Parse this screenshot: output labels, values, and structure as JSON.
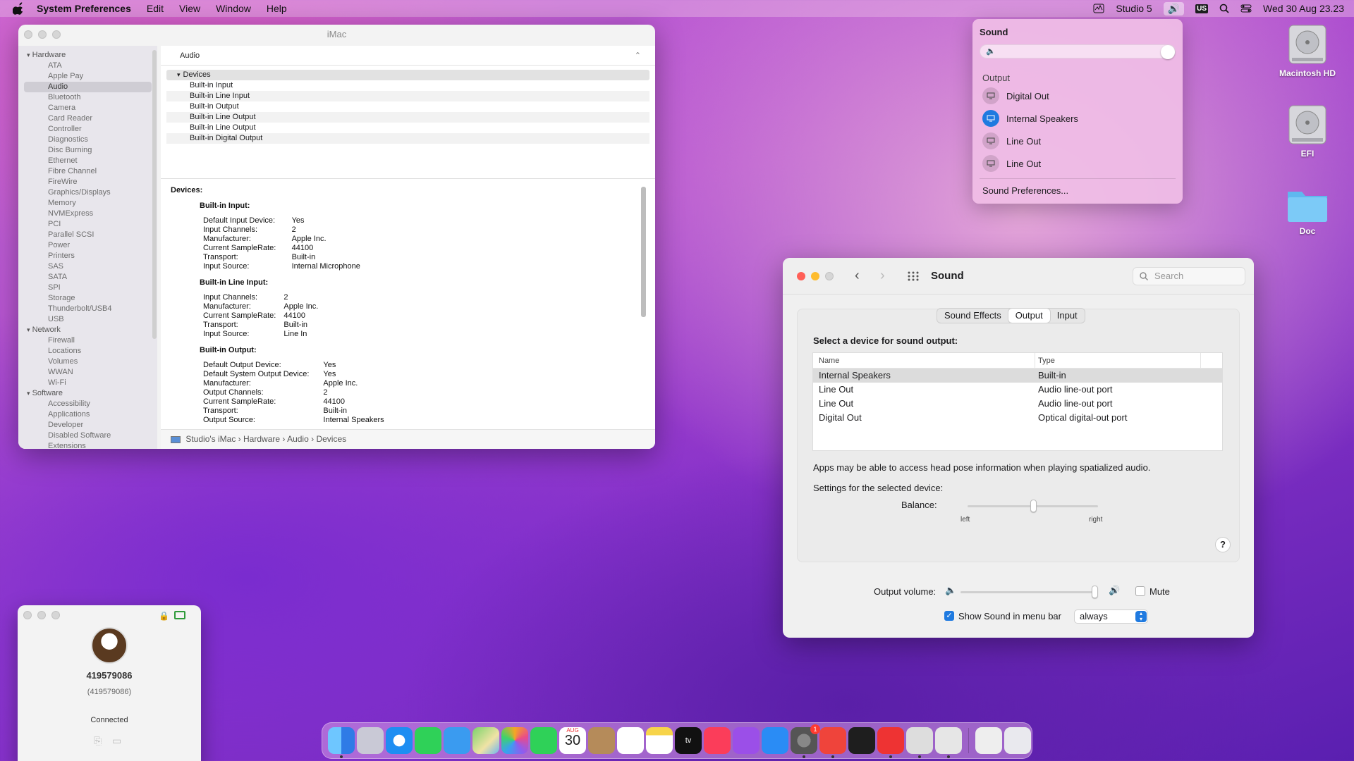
{
  "menubar": {
    "app": "System Preferences",
    "items": [
      "Edit",
      "View",
      "Window",
      "Help"
    ],
    "user": "Studio 5",
    "keyboard": "US",
    "clock": "Wed 30 Aug  23.23"
  },
  "sysinfo": {
    "title": "iMac",
    "sidebar": {
      "hardware_label": "Hardware",
      "hardware": [
        "ATA",
        "Apple Pay",
        "Audio",
        "Bluetooth",
        "Camera",
        "Card Reader",
        "Controller",
        "Diagnostics",
        "Disc Burning",
        "Ethernet",
        "Fibre Channel",
        "FireWire",
        "Graphics/Displays",
        "Memory",
        "NVMExpress",
        "PCI",
        "Parallel SCSI",
        "Power",
        "Printers",
        "SAS",
        "SATA",
        "SPI",
        "Storage",
        "Thunderbolt/USB4",
        "USB"
      ],
      "network_label": "Network",
      "network": [
        "Firewall",
        "Locations",
        "Volumes",
        "WWAN",
        "Wi-Fi"
      ],
      "software_label": "Software",
      "software": [
        "Accessibility",
        "Applications",
        "Developer",
        "Disabled Software",
        "Extensions"
      ]
    },
    "section": "Audio",
    "list_head": "Devices",
    "list": [
      "Built-in Input",
      "Built-in Line Input",
      "Built-in Output",
      "Built-in Line Output",
      "Built-in Line Output",
      "Built-in Digital Output"
    ],
    "detail_heading": "Devices:",
    "blocks": [
      {
        "title": "Built-in Input:",
        "rows": [
          [
            "Default Input Device:",
            "Yes"
          ],
          [
            "Input Channels:",
            "2"
          ],
          [
            "Manufacturer:",
            "Apple Inc."
          ],
          [
            "Current SampleRate:",
            "44100"
          ],
          [
            "Transport:",
            "Built-in"
          ],
          [
            "Input Source:",
            "Internal Microphone"
          ]
        ]
      },
      {
        "title": "Built-in Line Input:",
        "rows": [
          [
            "Input Channels:",
            "2"
          ],
          [
            "Manufacturer:",
            "Apple Inc."
          ],
          [
            "Current SampleRate:",
            "44100"
          ],
          [
            "Transport:",
            "Built-in"
          ],
          [
            "Input Source:",
            "Line In"
          ]
        ]
      },
      {
        "title": "Built-in Output:",
        "rows": [
          [
            "Default Output Device:",
            "Yes"
          ],
          [
            "Default System Output Device:",
            "Yes"
          ],
          [
            "Manufacturer:",
            "Apple Inc."
          ],
          [
            "Output Channels:",
            "2"
          ],
          [
            "Current SampleRate:",
            "44100"
          ],
          [
            "Transport:",
            "Built-in"
          ],
          [
            "Output Source:",
            "Internal Speakers"
          ]
        ]
      }
    ],
    "path": [
      "Studio's iMac",
      "Hardware",
      "Audio",
      "Devices"
    ]
  },
  "popup": {
    "title": "Sound",
    "volume_level": 1.0,
    "output_label": "Output",
    "devices": [
      "Digital Out",
      "Internal Speakers",
      "Line Out",
      "Line Out"
    ],
    "selected_device": "Internal Speakers",
    "prefs_link": "Sound Preferences..."
  },
  "desktop": {
    "icons": [
      "Macintosh HD",
      "EFI",
      "Doc"
    ]
  },
  "sound": {
    "title": "Sound",
    "search_placeholder": "Search",
    "tabs": [
      "Sound Effects",
      "Output",
      "Input"
    ],
    "active_tab": "Output",
    "prompt": "Select a device for sound output:",
    "columns": [
      "Name",
      "Type"
    ],
    "rows": [
      {
        "name": "Internal Speakers",
        "type": "Built-in"
      },
      {
        "name": "Line Out",
        "type": "Audio line-out port"
      },
      {
        "name": "Line Out",
        "type": "Audio line-out port"
      },
      {
        "name": "Digital Out",
        "type": "Optical digital-out port"
      }
    ],
    "spatial_note": "Apps may be able to access head pose information when playing spatialized audio.",
    "settings_label": "Settings for the selected device:",
    "balance_label": "Balance:",
    "balance_left": "left",
    "balance_right": "right",
    "balance_value": 0.5,
    "help": "?",
    "output_volume_label": "Output volume:",
    "output_volume": 1.0,
    "mute_label": "Mute",
    "mute": false,
    "show_in_menubar_label": "Show Sound in menu bar",
    "show_in_menubar": true,
    "menubar_option": "always"
  },
  "anydesk": {
    "id": "419579086",
    "alias": "(419579086)",
    "status": "Connected"
  },
  "dock": {
    "apps": [
      "finder-icon",
      "launchpad-icon",
      "safari-icon",
      "messages-icon",
      "mail-icon",
      "maps-icon",
      "photos-icon",
      "facetime-icon",
      "calendar-icon",
      "contacts-icon",
      "reminders-icon",
      "notes-icon",
      "tv-icon",
      "music-icon",
      "podcasts-icon",
      "app-store-icon",
      "system-preferences-icon",
      "anydesk-icon",
      "terminal-icon",
      "utility-icon",
      "editor-icon",
      "printer-icon",
      "file-icon",
      "trash-icon"
    ],
    "calendar_month": "AUG",
    "calendar_day": "30",
    "prefs_badge": "1"
  }
}
